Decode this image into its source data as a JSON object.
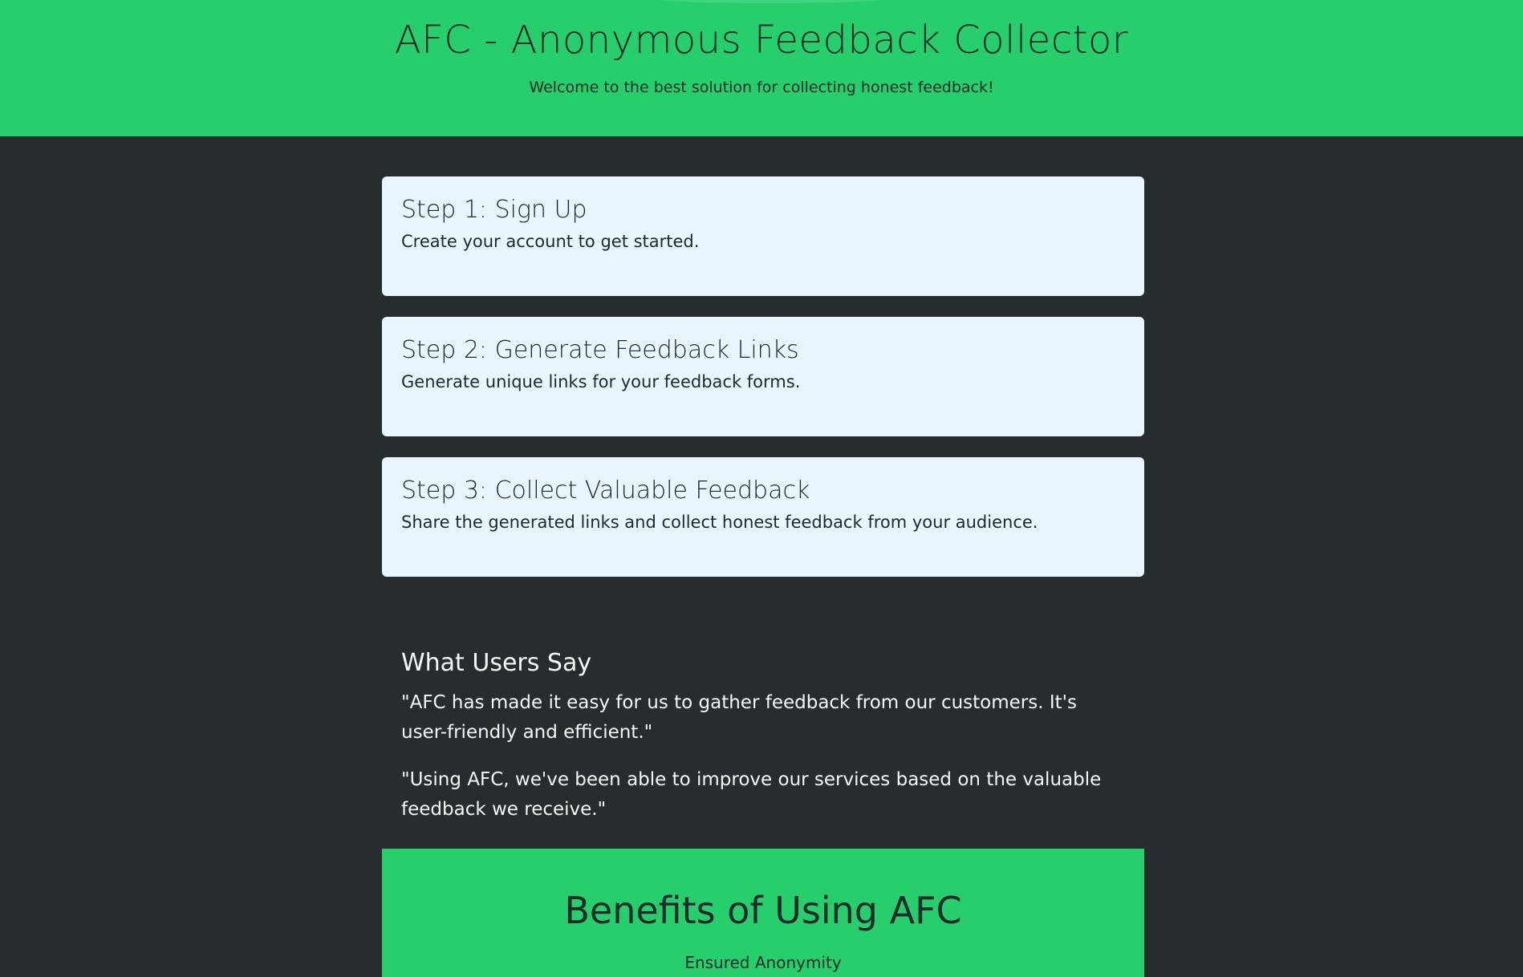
{
  "header": {
    "title": "AFC - Anonymous Feedback Collector",
    "subtitle": "Welcome to the best solution for collecting honest feedback!"
  },
  "steps": [
    {
      "title": "Step 1: Sign Up",
      "description": "Create your account to get started."
    },
    {
      "title": "Step 2: Generate Feedback Links",
      "description": "Generate unique links for your feedback forms."
    },
    {
      "title": "Step 3: Collect Valuable Feedback",
      "description": "Share the generated links and collect honest feedback from your audience."
    }
  ],
  "testimonials": {
    "title": "What Users Say",
    "quotes": [
      "\"AFC has made it easy for us to gather feedback from our customers. It's user-friendly and efficient.\"",
      "\"Using AFC, we've been able to improve our services based on the valuable feedback we receive.\""
    ]
  },
  "benefits": {
    "title": "Benefits of Using AFC",
    "partial_item": "Ensured Anonymity"
  },
  "colors": {
    "accent_green": "#26ce6c",
    "background_dark": "#272d2e",
    "card_background": "#eaf4fc",
    "text_dark": "#1d2a2c",
    "text_light": "#f4f7f8"
  }
}
